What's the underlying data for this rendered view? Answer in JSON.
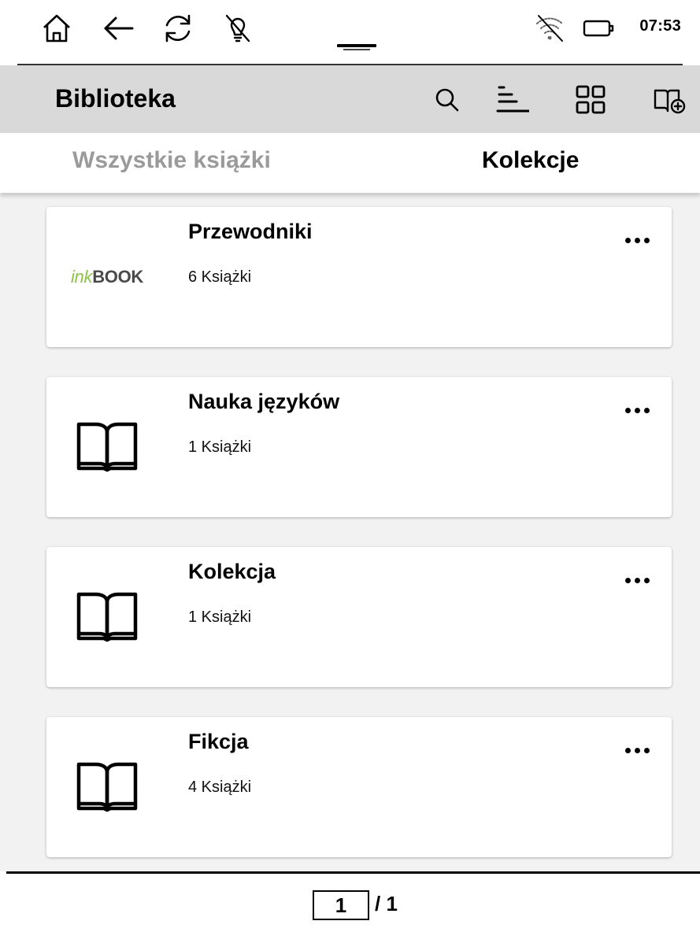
{
  "status_bar": {
    "time": "07:53",
    "icons": [
      "home-icon",
      "back-arrow-icon",
      "refresh-icon",
      "frontlight-off-icon",
      "wifi-off-icon",
      "battery-icon"
    ]
  },
  "app_bar": {
    "title": "Biblioteka",
    "icons": [
      "search-icon",
      "sort-icon",
      "grid-view-icon",
      "add-collection-icon"
    ]
  },
  "tabs": [
    {
      "label": "Wszystkie książki",
      "active": false
    },
    {
      "label": "Kolekcje",
      "active": true
    }
  ],
  "collections": [
    {
      "title": "Przewodniki",
      "count": "6 Książki",
      "thumbnail": "inkbook-logo",
      "logo_prefix": "ink",
      "logo_suffix": "BOOK"
    },
    {
      "title": "Nauka języków",
      "count": "1 Książki",
      "thumbnail": "open-book-icon"
    },
    {
      "title": "Kolekcja",
      "count": "1 Książki",
      "thumbnail": "open-book-icon"
    },
    {
      "title": "Fikcja",
      "count": "4 Książki",
      "thumbnail": "open-book-icon"
    }
  ],
  "pager": {
    "current": "1",
    "total_label": "/ 1"
  },
  "colors": {
    "app_bar_bg": "#d9d9d9",
    "list_bg": "#f2f2f2",
    "inactive_tab": "#9a9a9a",
    "logo_green": "#8bc34a"
  }
}
